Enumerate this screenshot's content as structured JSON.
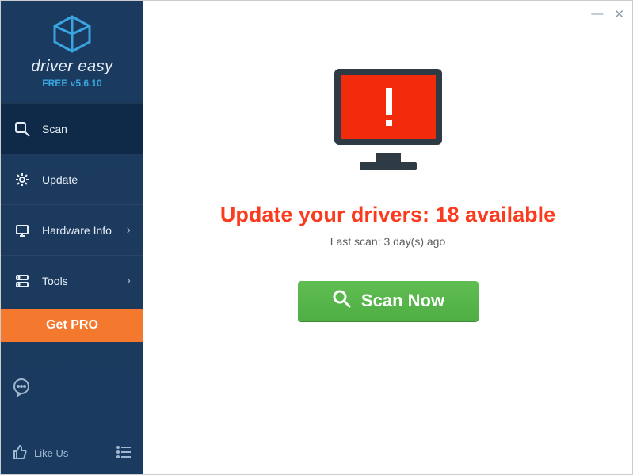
{
  "brand": {
    "name": "driver easy",
    "version_prefix": "FREE v",
    "version": "5.6.10"
  },
  "sidebar": {
    "items": [
      {
        "label": "Scan",
        "icon": "scan-icon",
        "active": true,
        "chevron": false
      },
      {
        "label": "Update",
        "icon": "gear-icon",
        "active": false,
        "chevron": false
      },
      {
        "label": "Hardware Info",
        "icon": "hardware-icon",
        "active": false,
        "chevron": true
      },
      {
        "label": "Tools",
        "icon": "tools-icon",
        "active": false,
        "chevron": true
      }
    ],
    "get_pro_label": "Get PRO",
    "like_label": "Like Us"
  },
  "main": {
    "headline_prefix": "Update your drivers: ",
    "available_count": 18,
    "headline_suffix": " available",
    "last_scan_prefix": "Last scan: ",
    "last_scan_value": "3 day(s) ago",
    "scan_button_label": "Scan Now"
  },
  "colors": {
    "alert_red": "#f12b0c",
    "accent_orange": "#f4792e",
    "action_green": "#55b549",
    "link_blue": "#3aa4e0",
    "sidebar_bg": "#1a3a5f"
  }
}
